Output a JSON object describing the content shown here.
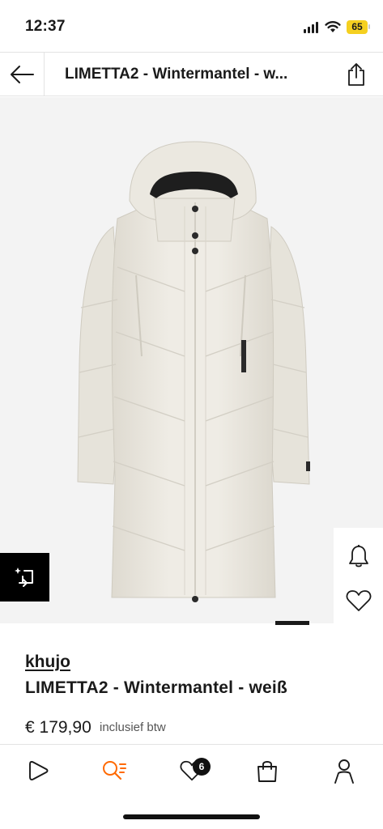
{
  "status_bar": {
    "time": "12:37",
    "battery": "65",
    "icons": [
      "signal-icon",
      "wifi-icon",
      "battery-icon"
    ]
  },
  "header": {
    "title": "LIMETTA2 - Wintermantel - w...",
    "back_icon": "arrow-left-icon",
    "share_icon": "share-icon"
  },
  "product": {
    "brand": "khujo",
    "name": "LIMETTA2 - Wintermantel - weiß",
    "price": "€ 179,90",
    "vat_note": "inclusief btw",
    "image_icons": [
      "try-on-icon",
      "bell-icon",
      "heart-icon"
    ],
    "carousel_active_index": 1
  },
  "bottom_nav": {
    "items": [
      {
        "name": "home",
        "icon": "play-icon"
      },
      {
        "name": "search",
        "icon": "search-icon",
        "active": true
      },
      {
        "name": "wishlist",
        "icon": "heart-icon",
        "badge": "6"
      },
      {
        "name": "bag",
        "icon": "bag-icon"
      },
      {
        "name": "account",
        "icon": "user-icon"
      }
    ]
  },
  "colors": {
    "accent": "#ff6900",
    "text": "#1a1a1a",
    "image_bg": "#f3f3f3",
    "coat": "#ece9e1",
    "battery": "#f5d020"
  }
}
